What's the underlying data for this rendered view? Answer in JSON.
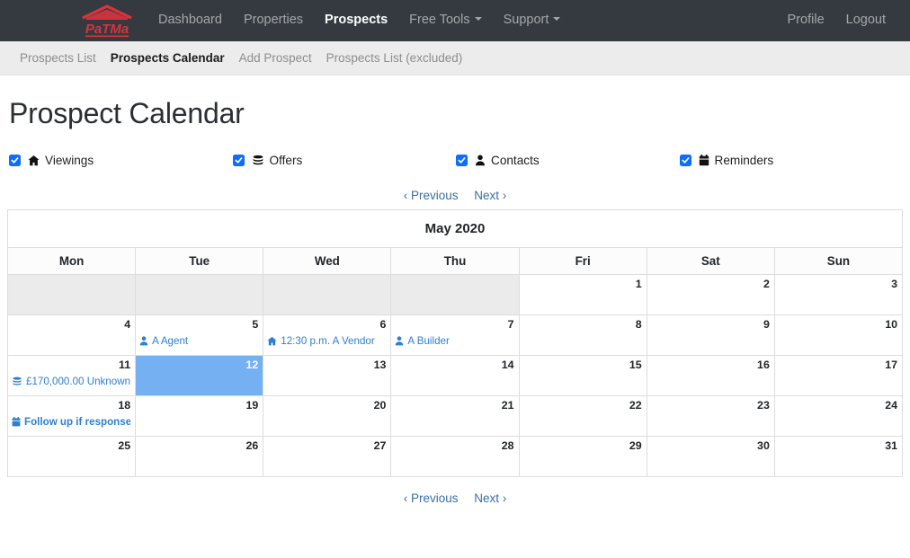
{
  "navbar": {
    "brand": {
      "name": "patma-logo",
      "text": "PaTMa",
      "color": "#d9343c"
    },
    "links": [
      {
        "label": "Dashboard",
        "active": false,
        "caret": false
      },
      {
        "label": "Properties",
        "active": false,
        "caret": false
      },
      {
        "label": "Prospects",
        "active": true,
        "caret": false
      },
      {
        "label": "Free Tools",
        "active": false,
        "caret": true
      },
      {
        "label": "Support",
        "active": false,
        "caret": true
      }
    ],
    "right_links": [
      {
        "label": "Profile"
      },
      {
        "label": "Logout"
      }
    ]
  },
  "subnav": {
    "items": [
      {
        "label": "Prospects List",
        "active": false
      },
      {
        "label": "Prospects Calendar",
        "active": true
      },
      {
        "label": "Add Prospect",
        "active": false
      },
      {
        "label": "Prospects List (excluded)",
        "active": false
      }
    ]
  },
  "page": {
    "title": "Prospect Calendar"
  },
  "filters": [
    {
      "label": "Viewings",
      "icon": "house-icon",
      "checked": true
    },
    {
      "label": "Offers",
      "icon": "coins-icon",
      "checked": true
    },
    {
      "label": "Contacts",
      "icon": "person-icon",
      "checked": true
    },
    {
      "label": "Reminders",
      "icon": "calendar-icon",
      "checked": true
    }
  ],
  "calendar_nav": {
    "previous": "‹ Previous",
    "next": "Next ›"
  },
  "calendar": {
    "title": "May 2020",
    "weekdays": [
      "Mon",
      "Tue",
      "Wed",
      "Thu",
      "Fri",
      "Sat",
      "Sun"
    ],
    "today": 12,
    "weeks": [
      [
        {
          "day": "",
          "blank": true,
          "events": []
        },
        {
          "day": "",
          "blank": true,
          "events": []
        },
        {
          "day": "",
          "blank": true,
          "events": []
        },
        {
          "day": "",
          "blank": true,
          "events": []
        },
        {
          "day": "1",
          "blank": false,
          "events": []
        },
        {
          "day": "2",
          "blank": false,
          "events": []
        },
        {
          "day": "3",
          "blank": false,
          "events": []
        }
      ],
      [
        {
          "day": "4",
          "blank": false,
          "events": []
        },
        {
          "day": "5",
          "blank": false,
          "events": [
            {
              "icon": "person-icon",
              "text": "A Agent",
              "type": "contact"
            }
          ]
        },
        {
          "day": "6",
          "blank": false,
          "events": [
            {
              "icon": "house-icon",
              "text": "12:30 p.m. A Vendor",
              "type": "viewing"
            }
          ]
        },
        {
          "day": "7",
          "blank": false,
          "events": [
            {
              "icon": "person-icon",
              "text": "A Builder",
              "type": "contact"
            }
          ]
        },
        {
          "day": "8",
          "blank": false,
          "events": []
        },
        {
          "day": "9",
          "blank": false,
          "events": []
        },
        {
          "day": "10",
          "blank": false,
          "events": []
        }
      ],
      [
        {
          "day": "11",
          "blank": false,
          "events": [
            {
              "icon": "coins-icon",
              "text": "£170,000.00 Unknown",
              "type": "offer"
            }
          ]
        },
        {
          "day": "12",
          "blank": false,
          "today": true,
          "events": []
        },
        {
          "day": "13",
          "blank": false,
          "events": []
        },
        {
          "day": "14",
          "blank": false,
          "events": []
        },
        {
          "day": "15",
          "blank": false,
          "events": []
        },
        {
          "day": "16",
          "blank": false,
          "events": []
        },
        {
          "day": "17",
          "blank": false,
          "events": []
        }
      ],
      [
        {
          "day": "18",
          "blank": false,
          "events": [
            {
              "icon": "calendar-icon",
              "text": "Follow up if response not rece",
              "type": "reminder"
            }
          ]
        },
        {
          "day": "19",
          "blank": false,
          "events": []
        },
        {
          "day": "20",
          "blank": false,
          "events": []
        },
        {
          "day": "21",
          "blank": false,
          "events": []
        },
        {
          "day": "22",
          "blank": false,
          "events": []
        },
        {
          "day": "23",
          "blank": false,
          "events": []
        },
        {
          "day": "24",
          "blank": false,
          "events": []
        }
      ],
      [
        {
          "day": "25",
          "blank": false,
          "events": []
        },
        {
          "day": "26",
          "blank": false,
          "events": []
        },
        {
          "day": "27",
          "blank": false,
          "events": []
        },
        {
          "day": "28",
          "blank": false,
          "events": []
        },
        {
          "day": "29",
          "blank": false,
          "events": []
        },
        {
          "day": "30",
          "blank": false,
          "events": []
        },
        {
          "day": "31",
          "blank": false,
          "events": []
        }
      ]
    ]
  },
  "colors": {
    "navbar_bg": "#343a40",
    "subnav_bg": "#ececec",
    "accent_blue": "#0d6efd",
    "link_blue": "#2f7fd1",
    "today_bg": "#74b0f2",
    "brand_red": "#d9343c",
    "blank_cell_bg": "#ebebeb"
  }
}
